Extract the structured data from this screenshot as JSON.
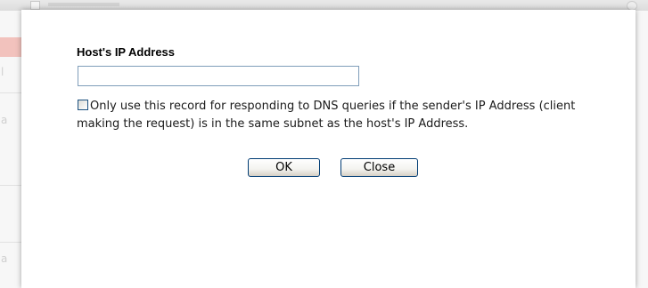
{
  "dialog": {
    "host_ip_label": "Host's IP Address",
    "host_ip_value": "",
    "option_text": "Only use this record for responding to DNS queries if the sender's IP Address (client making the request) is in the same subnet as the host's IP Address.",
    "option_checked": false,
    "ok_label": "OK",
    "close_label": "Close"
  },
  "colors": {
    "input_border": "#7f9db9",
    "button_border": "#003c74",
    "checkbox_border": "#1c5180"
  }
}
